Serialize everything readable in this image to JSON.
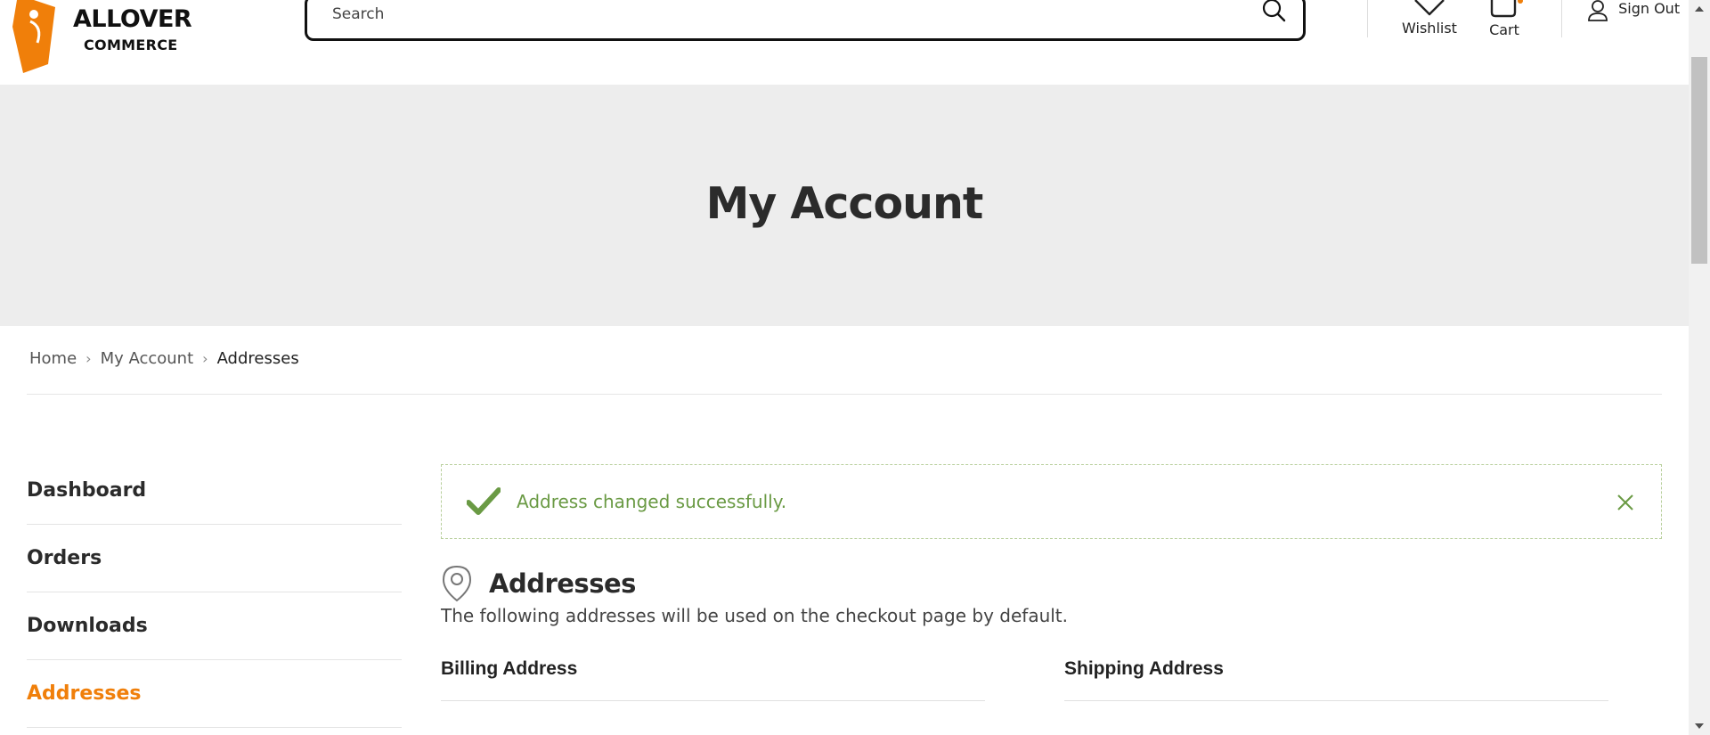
{
  "brand": {
    "line1": "ALLOVER",
    "line2": "COMMERCE",
    "color": "#f07f0a"
  },
  "search": {
    "placeholder": "Search",
    "value": ""
  },
  "header": {
    "wishlist_label": "Wishlist",
    "cart_label": "Cart",
    "signout_label": "Sign Out"
  },
  "banner": {
    "title": "My Account"
  },
  "breadcrumb": {
    "items": [
      "Home",
      "My Account",
      "Addresses"
    ]
  },
  "sidebar": {
    "items": [
      {
        "label": "Dashboard",
        "active": false
      },
      {
        "label": "Orders",
        "active": false
      },
      {
        "label": "Downloads",
        "active": false
      },
      {
        "label": "Addresses",
        "active": true
      }
    ],
    "active_color": "#f07f0a"
  },
  "notice": {
    "text": "Address changed successfully.",
    "color": "#6a9a44"
  },
  "addresses": {
    "title": "Addresses",
    "description": "The following addresses will be used on the checkout page by default.",
    "billing_title": "Billing Address",
    "shipping_title": "Shipping Address"
  }
}
